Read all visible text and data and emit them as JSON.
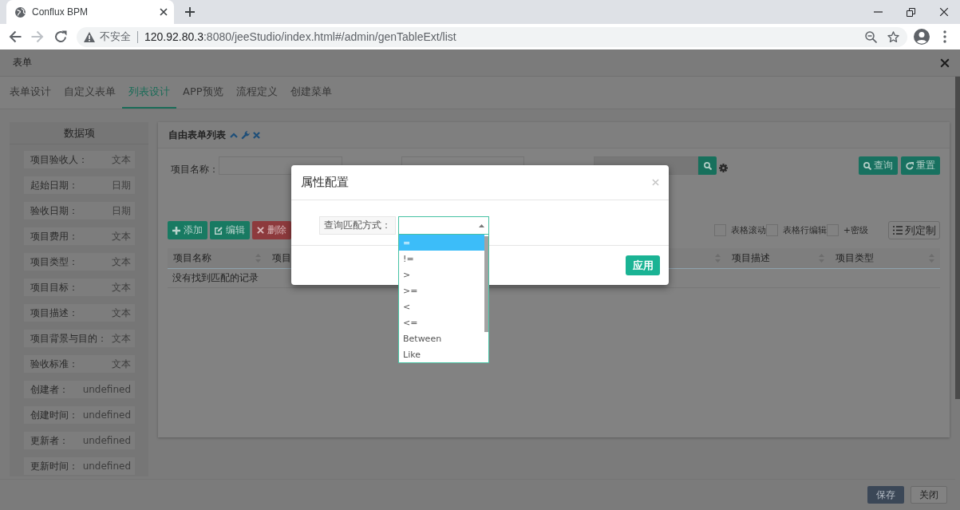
{
  "browser": {
    "tab_title": "Conflux BPM",
    "forward_disabled": true,
    "security_label": "不安全",
    "url_host": "120.92.80.3",
    "url_path": ":8080/jeeStudio/index.html#/admin/genTableExt/list"
  },
  "page": {
    "title": "表单"
  },
  "tabs": [
    {
      "label": "表单设计",
      "selected": false
    },
    {
      "label": "自定义表单",
      "selected": false
    },
    {
      "label": "列表设计",
      "selected": true
    },
    {
      "label": "APP预览",
      "selected": false
    },
    {
      "label": "流程定义",
      "selected": false
    },
    {
      "label": "创建菜单",
      "selected": false
    }
  ],
  "data_panel": {
    "title": "数据项",
    "items": [
      {
        "label": "项目验收人：",
        "type": "文本"
      },
      {
        "label": "起始日期：",
        "type": "日期"
      },
      {
        "label": "验收日期：",
        "type": "日期"
      },
      {
        "label": "项目费用：",
        "type": "文本"
      },
      {
        "label": "项目类型：",
        "type": "文本"
      },
      {
        "label": "项目目标：",
        "type": "文本"
      },
      {
        "label": "项目描述：",
        "type": "文本"
      },
      {
        "label": "项目背景与目的：",
        "type": "文本"
      },
      {
        "label": "验收标准：",
        "type": "文本"
      },
      {
        "label": "创建者：",
        "type": "undefined"
      },
      {
        "label": "创建时间：",
        "type": "undefined"
      },
      {
        "label": "更新者：",
        "type": "undefined"
      },
      {
        "label": "更新时间：",
        "type": "undefined"
      }
    ]
  },
  "list_panel": {
    "title": "自由表单列表",
    "search_label": "项目名称：",
    "query_button": "查询",
    "reset_button": "重置",
    "actions": [
      {
        "label": "添加",
        "kind": "add"
      },
      {
        "label": "编辑",
        "kind": "edit"
      },
      {
        "label": "删除",
        "kind": "delete"
      }
    ],
    "options": [
      {
        "label": "表格滚动",
        "checked": false
      },
      {
        "label": "表格行编辑",
        "checked": false
      },
      {
        "label": "+密级",
        "checked": false
      }
    ],
    "columns_button": "列定制",
    "columns": [
      "项目名称",
      "项目",
      "项目描述",
      "项目类型"
    ],
    "empty_message": "没有找到匹配的记录"
  },
  "footer": {
    "buttons": [
      {
        "label": "保存",
        "kind": "primary"
      },
      {
        "label": "关闭",
        "kind": "default"
      }
    ]
  },
  "dialog": {
    "title": "属性配置",
    "field_label": "查询匹配方式：",
    "select": {
      "expanded": true,
      "options": [
        {
          "label": "=",
          "selected": true
        },
        {
          "label": "!=",
          "selected": false
        },
        {
          "label": ">",
          "selected": false
        },
        {
          "label": ">=",
          "selected": false
        },
        {
          "label": "<",
          "selected": false
        },
        {
          "label": "<=",
          "selected": false
        },
        {
          "label": "Between",
          "selected": false
        },
        {
          "label": "Like",
          "selected": false
        }
      ]
    },
    "apply_button": "应用"
  }
}
